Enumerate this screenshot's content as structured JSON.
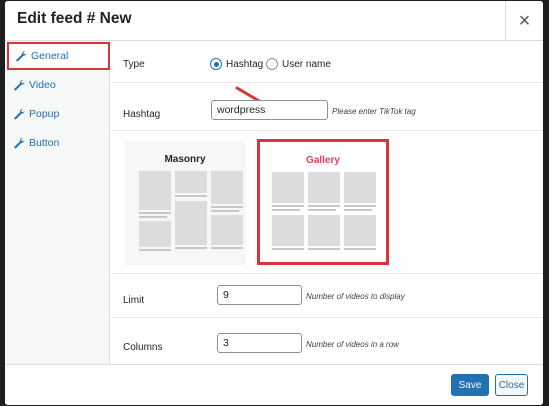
{
  "modal": {
    "title": "Edit feed # New",
    "close_glyph": "×"
  },
  "sidebar": {
    "items": [
      {
        "label": "General",
        "icon": "wrench-icon",
        "active": true
      },
      {
        "label": "Video",
        "icon": "wrench-icon",
        "active": false
      },
      {
        "label": "Popup",
        "icon": "wrench-icon",
        "active": false
      },
      {
        "label": "Button",
        "icon": "wrench-icon",
        "active": false
      }
    ]
  },
  "general": {
    "type_label": "Type",
    "type_options": [
      {
        "label": "Hashtag",
        "checked": true
      },
      {
        "label": "User name",
        "checked": false
      }
    ],
    "hashtag_label": "Hashtag",
    "hashtag_value": "wordpress",
    "hashtag_hint": "Please enter TikTok tag",
    "layouts": [
      {
        "label": "Masonry",
        "selected": false
      },
      {
        "label": "Gallery",
        "selected": true
      }
    ],
    "limit_label": "Limit",
    "limit_value": "9",
    "limit_hint": "Number of videos to display",
    "columns_label": "Columns",
    "columns_value": "3",
    "columns_hint": "Number of videos in a row"
  },
  "footer": {
    "save_label": "Save",
    "close_label": "Close"
  },
  "colors": {
    "accent": "#2271b1",
    "highlight": "#d63638",
    "gallery_title": "#e0405a"
  }
}
